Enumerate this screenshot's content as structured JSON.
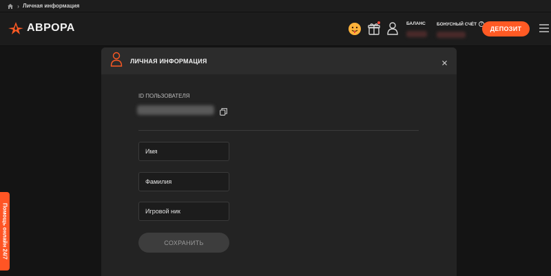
{
  "breadcrumb": {
    "home_icon": "home-icon",
    "separator": "›",
    "current": "Личная информация"
  },
  "header": {
    "logo_text": "АВРОРА",
    "logo_icon": "aurora-star-logo",
    "balance_label": "БАЛАНС",
    "bonus_label": "БОНУСНЫЙ СЧЁТ",
    "help_glyph": "?",
    "deposit_label": "ДЕПОЗИТ",
    "accent_color": "#ff5a24"
  },
  "modal": {
    "title": "ЛИЧНАЯ ИНФОРМАЦИЯ",
    "close_glyph": "×",
    "user_id_label": "ID ПОЛЬЗОВАТЕЛЯ",
    "fields": {
      "first_name": {
        "value": "",
        "placeholder": "Имя"
      },
      "last_name": {
        "value": "",
        "placeholder": "Фамилия"
      },
      "nickname": {
        "value": "",
        "placeholder": "Игровой ник"
      }
    },
    "save_label": "СОХРАНИТЬ"
  },
  "help_tab": {
    "label": "Помощь онлайн 24/7"
  }
}
